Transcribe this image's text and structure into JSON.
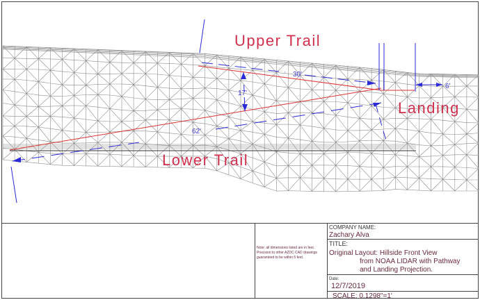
{
  "drawing": {
    "labels": {
      "upper_trail": "Upper Trail",
      "lower_trail": "Lower Trail",
      "landing": "Landing"
    },
    "dimensions": {
      "path_length": "62'",
      "upper_offset": "30'",
      "height": "17'",
      "landing_width": "6'"
    },
    "colors": {
      "mesh": "#8c8c8c",
      "path": "#e03030",
      "dimension": "#2a2ad8",
      "label": "#d0304e"
    }
  },
  "title_block": {
    "note": "Note: all dimensions listed are in feet. Precision to other AZDC CAD drawings guaranteed to be within 5 feet.",
    "company_label": "COMPANY NAME:",
    "company_value": "Zachary Alva",
    "title_label": "TITLE:",
    "title_lines": [
      "Original Layout: Hillside Front View",
      "from NOAA LIDAR with Pathway",
      "and Landing Projection."
    ],
    "date_label": "Date:",
    "date_value": "12/7/2019",
    "scale_label": "SCALE: 0.1298\"=1'"
  }
}
